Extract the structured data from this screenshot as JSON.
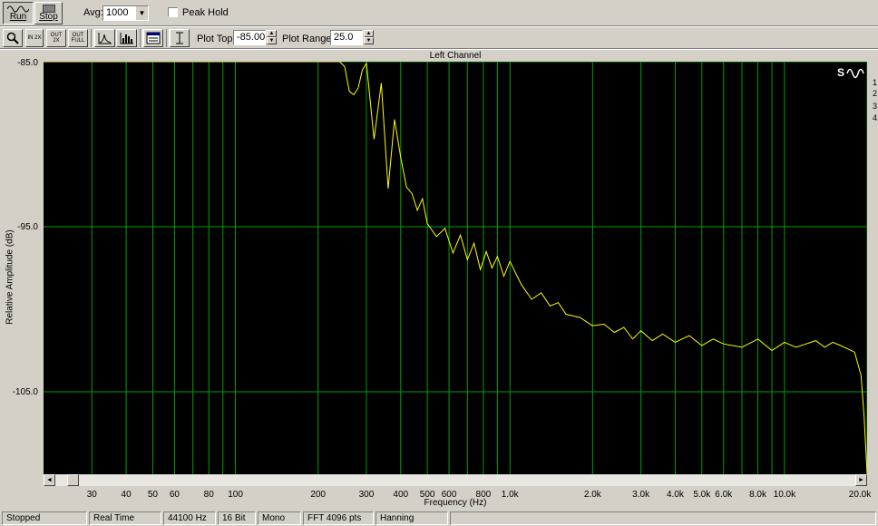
{
  "toolbar": {
    "run_label": "Run",
    "stop_label": "Stop",
    "avg_label": "Avg:",
    "avg_value": "1000",
    "peak_hold_label": "Peak Hold",
    "plot_top_label": "Plot Top:",
    "plot_top_value": "-85.00",
    "plot_range_label": "Plot Range:",
    "plot_range_value": "25.0",
    "zoom_in_2x_label": "IN 2X",
    "zoom_out_2x_label": "OUT 2X",
    "zoom_out_full_label": "OUT FULL"
  },
  "plot": {
    "channel_title": "Left Channel",
    "xlabel": "Frequency (Hz)",
    "ylabel": "Relative Amplitude (dB)"
  },
  "chart_data": {
    "type": "line",
    "title": "Left Channel",
    "xlabel": "Frequency (Hz)",
    "ylabel": "Relative Amplitude (dB)",
    "x_scale": "log",
    "xlim": [
      20,
      20000
    ],
    "ylim": [
      -110,
      -85
    ],
    "y_ticks": [
      -85,
      -95,
      -105
    ],
    "y_tick_labels": [
      "-85.0",
      "-95.0",
      "-105.0"
    ],
    "x_tick_labels": [
      {
        "f": 30,
        "label": "30"
      },
      {
        "f": 40,
        "label": "40"
      },
      {
        "f": 50,
        "label": "50"
      },
      {
        "f": 60,
        "label": "60"
      },
      {
        "f": 80,
        "label": "80"
      },
      {
        "f": 100,
        "label": "100"
      },
      {
        "f": 200,
        "label": "200"
      },
      {
        "f": 300,
        "label": "300"
      },
      {
        "f": 400,
        "label": "400"
      },
      {
        "f": 500,
        "label": "500"
      },
      {
        "f": 600,
        "label": "600"
      },
      {
        "f": 800,
        "label": "800"
      },
      {
        "f": 1000,
        "label": "1.0k"
      },
      {
        "f": 2000,
        "label": "2.0k"
      },
      {
        "f": 3000,
        "label": "3.0k"
      },
      {
        "f": 4000,
        "label": "4.0k"
      },
      {
        "f": 5000,
        "label": "5.0k"
      },
      {
        "f": 6000,
        "label": "6.0k"
      },
      {
        "f": 8000,
        "label": "8.0k"
      },
      {
        "f": 10000,
        "label": "10.0k"
      },
      {
        "f": 20000,
        "label": "20.0k"
      }
    ],
    "grid_freqs": [
      30,
      40,
      50,
      60,
      70,
      80,
      90,
      100,
      200,
      300,
      400,
      500,
      600,
      700,
      800,
      900,
      1000,
      2000,
      3000,
      4000,
      5000,
      6000,
      7000,
      8000,
      9000,
      10000,
      20000
    ],
    "grid": true,
    "line_color": "#ffff00",
    "grid_color": "#00a000",
    "background": "#000000",
    "series": [
      {
        "x": [
          20,
          100,
          200,
          240,
          250,
          260,
          270,
          280,
          290,
          300,
          320,
          340,
          360,
          380,
          400,
          420,
          440,
          460,
          480,
          500,
          540,
          580,
          620,
          660,
          700,
          740,
          780,
          820,
          860,
          900,
          950,
          1000,
          1100,
          1200,
          1300,
          1400,
          1500,
          1600,
          1800,
          2000,
          2200,
          2400,
          2600,
          2800,
          3000,
          3300,
          3600,
          4000,
          4500,
          5000,
          5500,
          6000,
          7000,
          8000,
          9000,
          10000,
          11000,
          12000,
          13000,
          14000,
          15000,
          16000,
          17000,
          18000,
          19000,
          19500,
          20000
        ],
        "y": [
          -85.0,
          -85.0,
          -85.0,
          -85.0,
          -85.3,
          -86.8,
          -87.0,
          -86.6,
          -85.5,
          -85.1,
          -89.7,
          -86.3,
          -92.7,
          -88.5,
          -90.8,
          -92.6,
          -93.0,
          -94.0,
          -93.3,
          -94.8,
          -95.6,
          -95.1,
          -96.6,
          -95.5,
          -97.0,
          -96.0,
          -97.6,
          -96.5,
          -97.5,
          -96.8,
          -98.0,
          -97.1,
          -98.5,
          -99.4,
          -99.0,
          -99.8,
          -99.6,
          -100.3,
          -100.5,
          -101.0,
          -100.9,
          -101.4,
          -101.1,
          -101.8,
          -101.3,
          -101.9,
          -101.5,
          -102.0,
          -101.6,
          -102.2,
          -101.8,
          -102.1,
          -102.3,
          -101.8,
          -102.5,
          -102.0,
          -102.3,
          -102.1,
          -101.9,
          -102.3,
          -102.0,
          -102.2,
          -102.4,
          -102.6,
          -104.0,
          -106.5,
          -110.0
        ]
      }
    ]
  },
  "scrollbar": {
    "left_arrow": "◄",
    "right_arrow": "►"
  },
  "side_icons": [
    "1",
    "2",
    "3",
    "4"
  ],
  "status": {
    "state": "Stopped",
    "mode": "Real Time",
    "sample_rate": "44100 Hz",
    "bits": "16 Bit",
    "channels": "Mono",
    "fft": "FFT 4096 pts",
    "window": "Hanning"
  }
}
